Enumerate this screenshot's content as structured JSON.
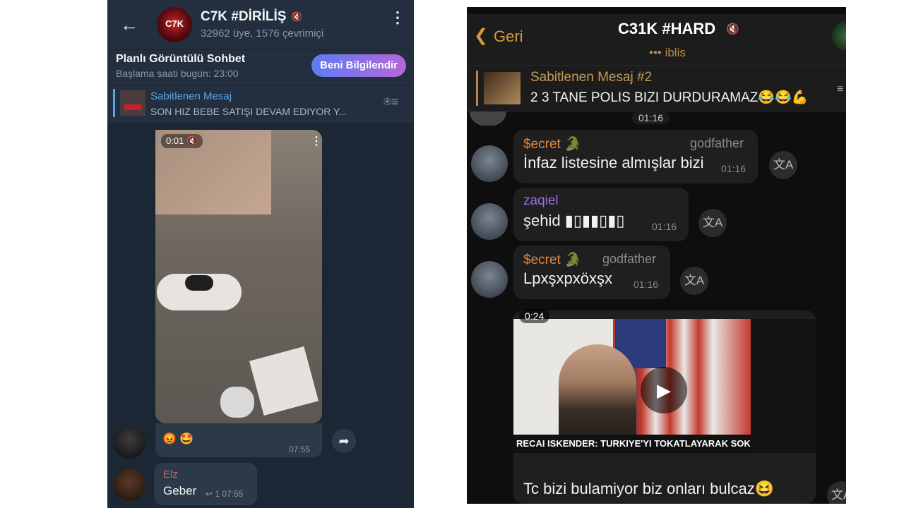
{
  "left": {
    "header": {
      "title": "C7K #DİRİLİŞ",
      "subtitle": "32962 üye, 1576 çevrimiçi",
      "avatar_text": "C7K",
      "back_icon": "←",
      "menu_icon": "⋮",
      "mute_icon": "🔇"
    },
    "voice_chat": {
      "title": "Planlı Görüntülü Sohbet",
      "subtitle": "Başlama saati bugün: 23:00",
      "button": "Beni Bilgilendir"
    },
    "pinned": {
      "title": "Sabitlenen Mesaj",
      "text": "SON HIZ BEBE SATIŞI DEVAM EDIYOR  Y...",
      "icon": "⍟≡"
    },
    "video_message": {
      "duration": "0:01",
      "muted_icon": "🔇",
      "menu_icon": "⋮",
      "reactions": "😡 🤩",
      "time": "07:55",
      "forward_icon": "➦"
    },
    "message": {
      "sender": "Elz",
      "text": "Geber",
      "meta": "↩ 1 07:55"
    }
  },
  "right": {
    "header": {
      "back_icon": "❮",
      "back_label": "Geri",
      "title": "C31K #HARD",
      "mute_icon": "🔇",
      "subtitle": "••• iblis"
    },
    "pinned": {
      "title": "Sabitlenen Mesaj #2",
      "text": "2 3 TANE POLIS BIZI DURDURAMAZ😂😂💪",
      "icon": "≡"
    },
    "top_time": "01:16",
    "messages": [
      {
        "sender": "$ecret",
        "badge": "🐊",
        "tag": "godfather",
        "text": "İnfaz listesine almışlar bizi",
        "time": "01:16",
        "translate_icon": "文A"
      },
      {
        "sender": "zaqiel",
        "text": "şehid ▮▯▮▮▯▮▯",
        "time": "01:16",
        "translate_icon": "文A"
      },
      {
        "sender": "$ecret",
        "badge": "🐊",
        "tag": "godfather",
        "text": "Lpxşxpxöxşx",
        "time": "01:16",
        "translate_icon": "文A"
      }
    ],
    "video_post": {
      "duration": "0:24",
      "play_icon": "▶",
      "caption": "RECAI ISKENDER: TURKIYE'YI TOKATLAYARAK SOK T...",
      "text": "Tc bizi bulamiyor biz onları bulcaz😆",
      "translate_icon": "文A"
    }
  }
}
